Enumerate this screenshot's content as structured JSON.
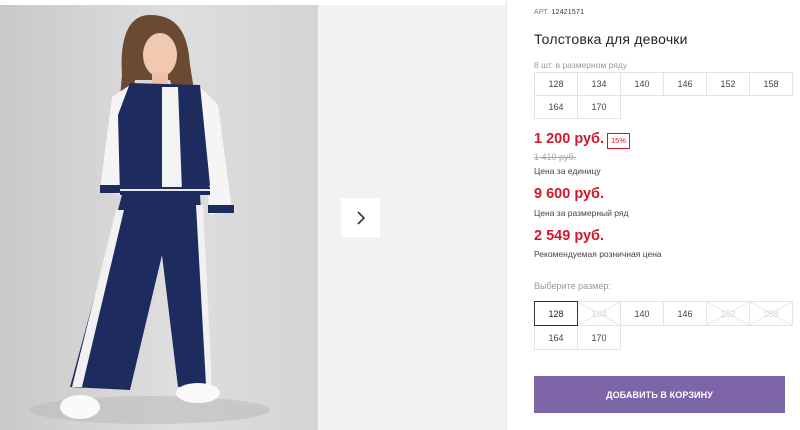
{
  "product": {
    "art_label": "АРТ.",
    "art_number": "12421571",
    "title": "Толстовка для девочки",
    "row_note": "8 шт. в размерном ряду",
    "size_row": [
      "128",
      "134",
      "140",
      "146",
      "152",
      "158",
      "164",
      "170"
    ]
  },
  "gallery": {
    "next_icon": "chevron-right-icon",
    "photo_alt": "Girl wearing navy varsity jacket and navy track pants"
  },
  "pricing": {
    "price": "1 200 руб.",
    "discount": "15%",
    "old_price": "1 410 руб.",
    "unit_label": "Цена за единицу",
    "row_price": "9 600 руб.",
    "row_label": "Цена за размерный ряд",
    "retail_price": "2 549 руб.",
    "retail_label": "Рекомендуемая розничная цена",
    "accent_color": "#d2182b"
  },
  "size_select": {
    "label": "Выберите размер:",
    "options": [
      {
        "size": "128",
        "state": "selected"
      },
      {
        "size": "134",
        "state": "disabled"
      },
      {
        "size": "140",
        "state": "available"
      },
      {
        "size": "146",
        "state": "available"
      },
      {
        "size": "152",
        "state": "disabled"
      },
      {
        "size": "158",
        "state": "disabled"
      },
      {
        "size": "164",
        "state": "available"
      },
      {
        "size": "170",
        "state": "available"
      }
    ]
  },
  "cart": {
    "button_label": "ДОБАВИТЬ В КОРЗИНУ",
    "button_color": "#7d65a7"
  }
}
